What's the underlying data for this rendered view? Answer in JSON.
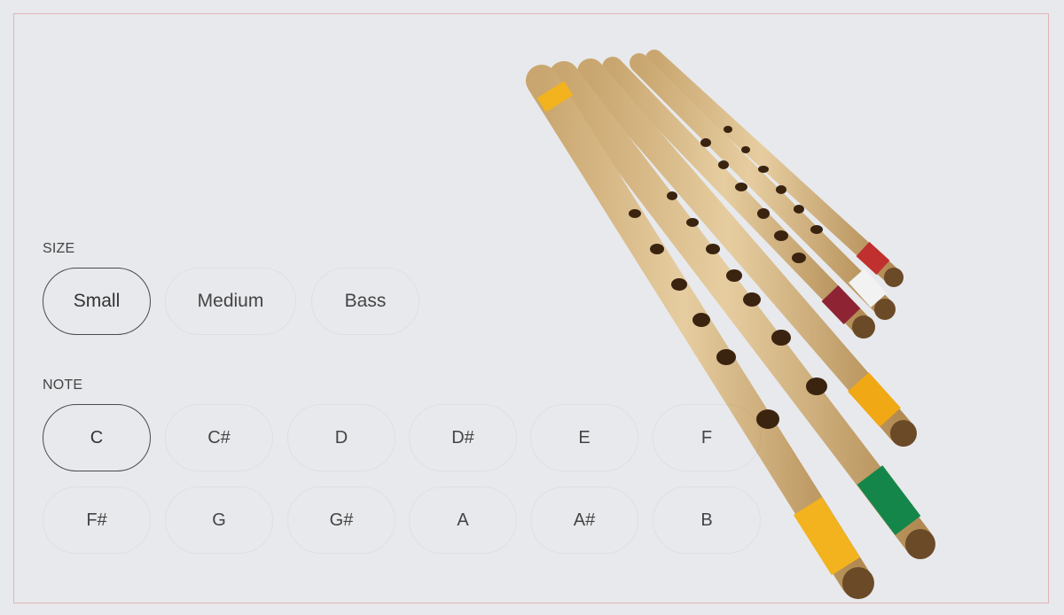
{
  "size": {
    "label": "SIZE",
    "options": [
      {
        "label": "Small",
        "selected": true
      },
      {
        "label": "Medium",
        "selected": false
      },
      {
        "label": "Bass",
        "selected": false
      }
    ]
  },
  "note": {
    "label": "NOTE",
    "options": [
      {
        "label": "C",
        "selected": true
      },
      {
        "label": "C#",
        "selected": false
      },
      {
        "label": "D",
        "selected": false
      },
      {
        "label": "D#",
        "selected": false
      },
      {
        "label": "E",
        "selected": false
      },
      {
        "label": "F",
        "selected": false
      },
      {
        "label": "F#",
        "selected": false
      },
      {
        "label": "G",
        "selected": false
      },
      {
        "label": "G#",
        "selected": false
      },
      {
        "label": "A",
        "selected": false
      },
      {
        "label": "A#",
        "selected": false
      },
      {
        "label": "B",
        "selected": false
      }
    ]
  },
  "colors": {
    "background": "#e8e9ec",
    "frame_border": "#e0b4b8",
    "selected_border": "#4a4a4a",
    "bamboo": "#d8bb8a",
    "bamboo_shade": "#b8955e"
  },
  "image": {
    "subject": "bamboo-flutes-photo"
  }
}
